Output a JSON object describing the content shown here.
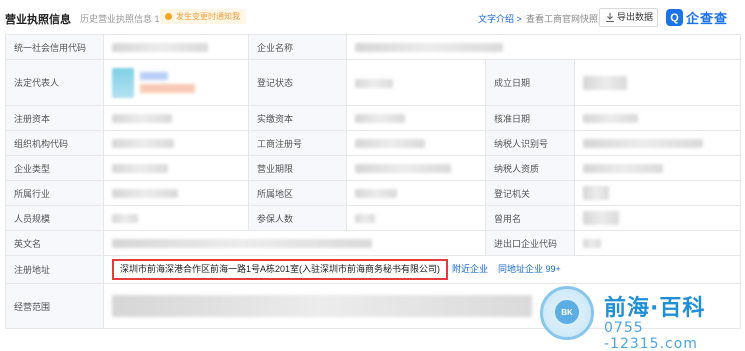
{
  "header": {
    "title": "营业执照信息",
    "history_label": "历史营业执照信息",
    "history_count": "1",
    "tip_badge": "发生变更时通知我",
    "text_intro": "文字介绍 >",
    "snapshot": "查看工商官网快照",
    "export_label": "导出数据",
    "logo_name": "企查查",
    "logo_mark": "Q"
  },
  "labels": {
    "credit_code": "统一社会信用代码",
    "company_name": "企业名称",
    "legal_rep": "法定代表人",
    "reg_status": "登记状态",
    "est_date": "成立日期",
    "reg_capital": "注册资本",
    "paid_capital": "实缴资本",
    "approval_date": "核准日期",
    "org_code": "组织机构代码",
    "biz_reg_no": "工商注册号",
    "taxpayer_id": "纳税人识别号",
    "company_type": "企业类型",
    "biz_term": "营业期限",
    "taxpayer_qual": "纳税人资质",
    "industry": "所属行业",
    "region": "所属地区",
    "reg_authority": "登记机关",
    "staff_size": "人员规模",
    "insured": "参保人数",
    "former_name": "曾用名",
    "english_name": "英文名",
    "import_export_code": "进出口企业代码",
    "reg_address": "注册地址",
    "biz_scope": "经营范围"
  },
  "address": {
    "value": "深圳市前海深港合作区前海一路1号A栋201室(入驻深圳市前海商务秘书有限公司)",
    "nearby_link": "附近企业",
    "same_address_link": "同地址企业 99+"
  },
  "watermark": {
    "badge": "BK",
    "brand": "前海·百科",
    "phone": "0755 -12315.com"
  },
  "colors": {
    "accent": "#1668dc",
    "highlight_border": "#e63b3b",
    "label_bg": "#f6f8fb",
    "tip_bg": "#fff6e6",
    "tip_text": "#f2a03f"
  }
}
